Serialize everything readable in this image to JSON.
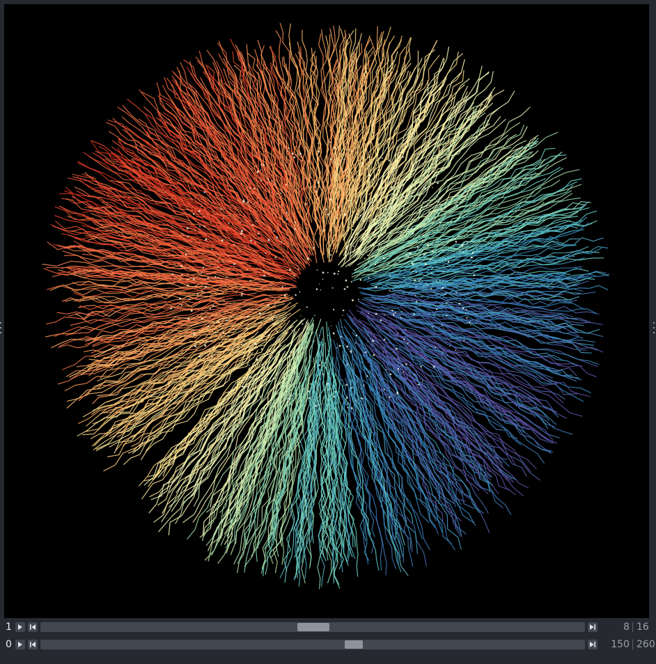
{
  "viewer": {
    "canvas": {
      "background": "#000000",
      "content": "colored-radial-track-lines"
    },
    "colormap": [
      "#d7301f",
      "#f46d43",
      "#fdae61",
      "#fee08b",
      "#ffffbf",
      "#abdda4",
      "#66d2c8",
      "#3288bd",
      "#5e4fa2"
    ]
  },
  "dims": {
    "rows": [
      {
        "axis_label": "1",
        "play_icon": "play-icon",
        "step_back_icon": "step-back-icon",
        "step_forward_icon": "step-forward-icon",
        "current": "8",
        "total": "16",
        "position_fraction": 0.5
      },
      {
        "axis_label": "0",
        "play_icon": "play-icon",
        "step_back_icon": "step-back-icon",
        "step_forward_icon": "step-forward-icon",
        "current": "150",
        "total": "260",
        "position_fraction": 0.577
      }
    ]
  },
  "colors": {
    "panel_bg": "#262930",
    "control_bg": "#414851",
    "thumb": "#8d949d",
    "text": "#f0f1f2",
    "muted_text": "#9aa0a8"
  }
}
